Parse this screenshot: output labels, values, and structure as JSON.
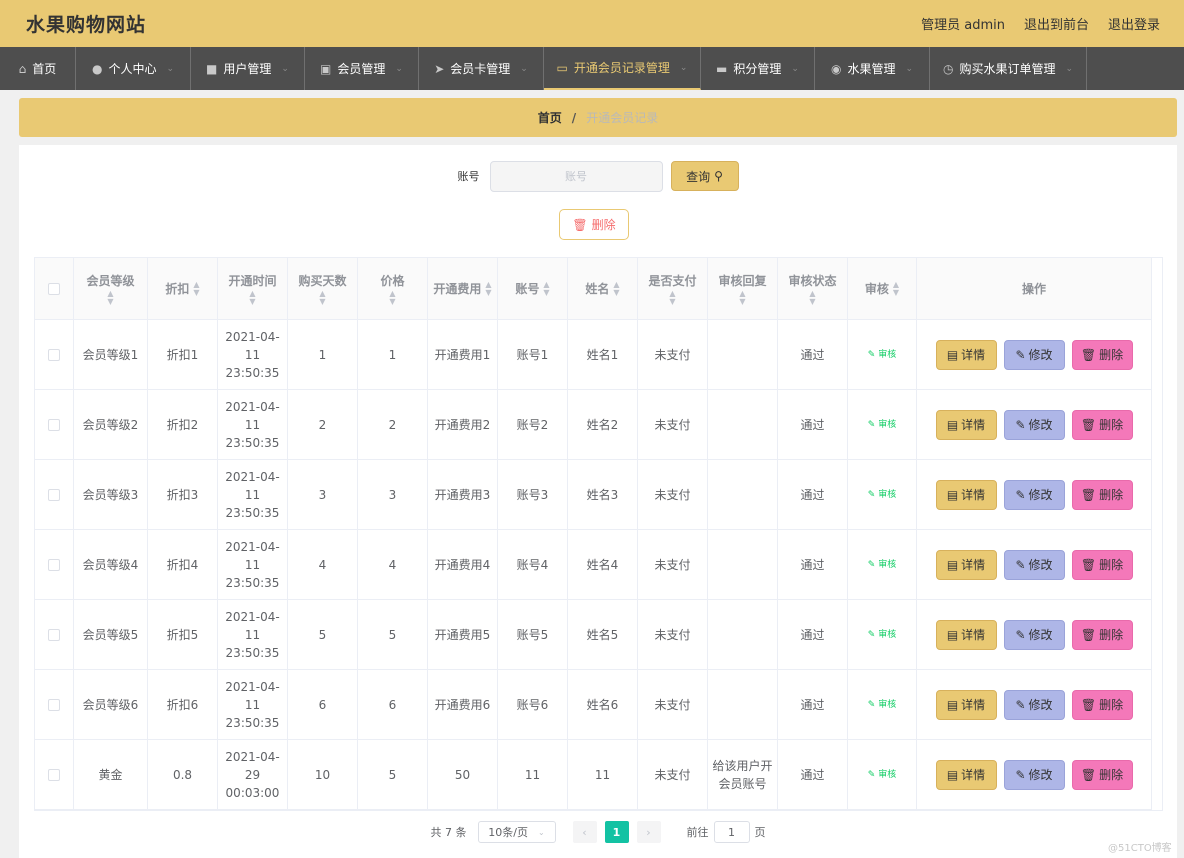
{
  "header": {
    "title": "水果购物网站",
    "links": [
      "管理员 admin",
      "退出到前台",
      "退出登录"
    ]
  },
  "nav": {
    "items": [
      {
        "label": "首页",
        "icon": "home-icon",
        "width": 76
      },
      {
        "label": "个人中心",
        "icon": "user-icon",
        "width": 115
      },
      {
        "label": "用户管理",
        "icon": "user-manage-icon",
        "width": 114
      },
      {
        "label": "会员管理",
        "icon": "clipboard-icon",
        "width": 114
      },
      {
        "label": "会员卡管理",
        "icon": "send-icon",
        "width": 125
      },
      {
        "label": "开通会员记录管理",
        "icon": "message-icon",
        "width": 157,
        "active": true
      },
      {
        "label": "积分管理",
        "icon": "chat-icon",
        "width": 114
      },
      {
        "label": "水果管理",
        "icon": "location-icon",
        "width": 115
      },
      {
        "label": "购买水果订单管理",
        "icon": "clock-icon",
        "width": 157
      }
    ]
  },
  "breadcrumb": {
    "home": "首页",
    "separator": "/",
    "current": "开通会员记录"
  },
  "search": {
    "label": "账号",
    "placeholder": "账号",
    "value": "",
    "button_label": "查询"
  },
  "delete_button_label": "删除",
  "table": {
    "columns": [
      "会员等级",
      "折扣",
      "开通时间",
      "购买天数",
      "价格",
      "开通费用",
      "账号",
      "姓名",
      "是否支付",
      "审核回复",
      "审核状态",
      "审核",
      "操作"
    ],
    "rows": [
      {
        "level": "会员等级1",
        "discount": "折扣1",
        "time": "2021-04-11 23:50:35",
        "days": "1",
        "price": "1",
        "fee": "开通费用1",
        "account": "账号1",
        "name": "姓名1",
        "paid": "未支付",
        "reply": "",
        "status": "通过"
      },
      {
        "level": "会员等级2",
        "discount": "折扣2",
        "time": "2021-04-11 23:50:35",
        "days": "2",
        "price": "2",
        "fee": "开通费用2",
        "account": "账号2",
        "name": "姓名2",
        "paid": "未支付",
        "reply": "",
        "status": "通过"
      },
      {
        "level": "会员等级3",
        "discount": "折扣3",
        "time": "2021-04-11 23:50:35",
        "days": "3",
        "price": "3",
        "fee": "开通费用3",
        "account": "账号3",
        "name": "姓名3",
        "paid": "未支付",
        "reply": "",
        "status": "通过"
      },
      {
        "level": "会员等级4",
        "discount": "折扣4",
        "time": "2021-04-11 23:50:35",
        "days": "4",
        "price": "4",
        "fee": "开通费用4",
        "account": "账号4",
        "name": "姓名4",
        "paid": "未支付",
        "reply": "",
        "status": "通过"
      },
      {
        "level": "会员等级5",
        "discount": "折扣5",
        "time": "2021-04-11 23:50:35",
        "days": "5",
        "price": "5",
        "fee": "开通费用5",
        "account": "账号5",
        "name": "姓名5",
        "paid": "未支付",
        "reply": "",
        "status": "通过"
      },
      {
        "level": "会员等级6",
        "discount": "折扣6",
        "time": "2021-04-11 23:50:35",
        "days": "6",
        "price": "6",
        "fee": "开通费用6",
        "account": "账号6",
        "name": "姓名6",
        "paid": "未支付",
        "reply": "",
        "status": "通过"
      },
      {
        "level": "黄金",
        "discount": "0.8",
        "time": "2021-04-29 00:03:00",
        "days": "10",
        "price": "5",
        "fee": "50",
        "account": "11",
        "name": "11",
        "paid": "未支付",
        "reply": "给该用户开会员账号",
        "status": "通过"
      }
    ],
    "audit_label": "审核",
    "actions": {
      "detail": "详情",
      "edit": "修改",
      "delete": "删除"
    }
  },
  "pagination": {
    "total": "共 7 条",
    "page_size": "10条/页",
    "current_page": "1",
    "goto_label": "前往",
    "goto_value": "1",
    "page_suffix": "页"
  },
  "watermark": "@51CTO博客",
  "colors": {
    "accent": "#e9c973",
    "nav_bg": "#4e4e4e",
    "active_page": "#13c2a3",
    "delete_pink": "#f478b9",
    "edit_blue": "#aeb6e7"
  }
}
